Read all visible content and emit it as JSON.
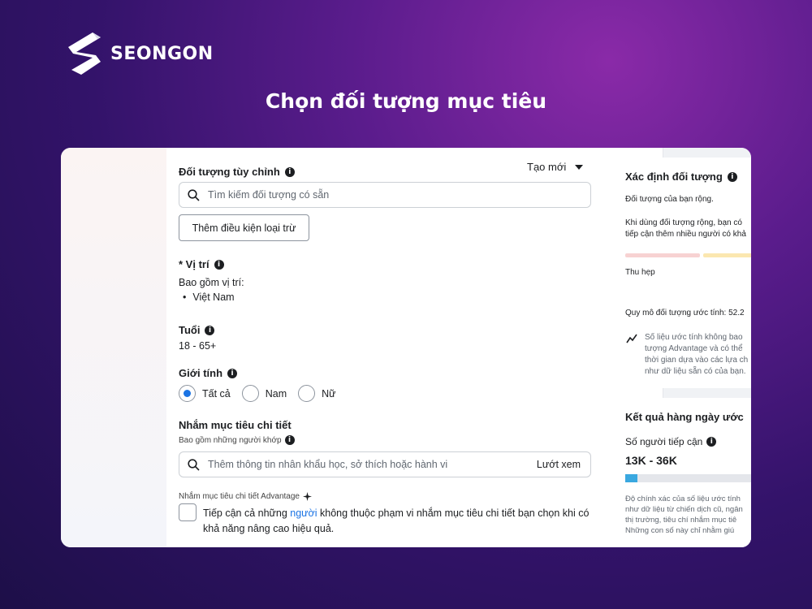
{
  "brand": {
    "name": "SEONGON"
  },
  "headline": "Chọn đối tượng mục tiêu",
  "custom_audience": {
    "label": "Đối tượng tùy chỉnh",
    "create_new": "Tạo mới",
    "search_placeholder": "Tìm kiếm đối tượng có sẵn",
    "exclude_button": "Thêm điều kiện loại trừ"
  },
  "location": {
    "label": "* Vị trí",
    "includes": "Bao gồm vị trí:",
    "items": [
      "Việt Nam"
    ]
  },
  "age": {
    "label": "Tuổi",
    "value": "18 - 65+"
  },
  "gender": {
    "label": "Giới tính",
    "options": [
      "Tất cả",
      "Nam",
      "Nữ"
    ],
    "selected": "Tất cả"
  },
  "detailed_targeting": {
    "label": "Nhắm mục tiêu chi tiết",
    "sublabel": "Bao gồm những người khớp",
    "search_placeholder": "Thêm thông tin nhân khẩu học, sở thích hoặc hành vi",
    "browse": "Lướt xem",
    "advantage_label": "Nhắm mục tiêu chi tiết Advantage",
    "checkbox_text_1": "Tiếp cận cả những ",
    "checkbox_link": "người",
    "checkbox_text_2": " không thuộc phạm vi nhắm mục tiêu chi tiết bạn chọn khi có",
    "checkbox_text_3": "khả năng nâng cao hiệu quả."
  },
  "audience_definition": {
    "title": "Xác định đối tượng",
    "status": "Đối tượng của bạn rộng.",
    "desc_1": "Khi dùng đối tượng rộng, bạn có",
    "desc_2": "tiếp cận thêm nhiều người có khả",
    "narrow": "Thu hẹp",
    "size_label": "Quy mô đối tượng ước tính: 52.2",
    "note_1": "Số liệu ước tính không bao",
    "note_2": "tượng Advantage và có thể",
    "note_3": "thời gian dựa vào các lựa ch",
    "note_4": "như dữ liệu sẵn có của bạn."
  },
  "daily_results": {
    "title": "Kết quả hàng ngày ước",
    "reach_label": "Số người tiếp cận",
    "reach_value": "13K - 36K",
    "note_1": "Độ chính xác của số liệu ước tính",
    "note_2": "như dữ liệu từ chiến dịch cũ, ngân",
    "note_3": "thị trường, tiêu chí nhắm mục tiê",
    "note_4": "Những con số này chỉ nhằm giú"
  },
  "colors": {
    "accent": "#1b74e4",
    "meter_bar": "#3aa8e0",
    "bg": "#33136a"
  }
}
